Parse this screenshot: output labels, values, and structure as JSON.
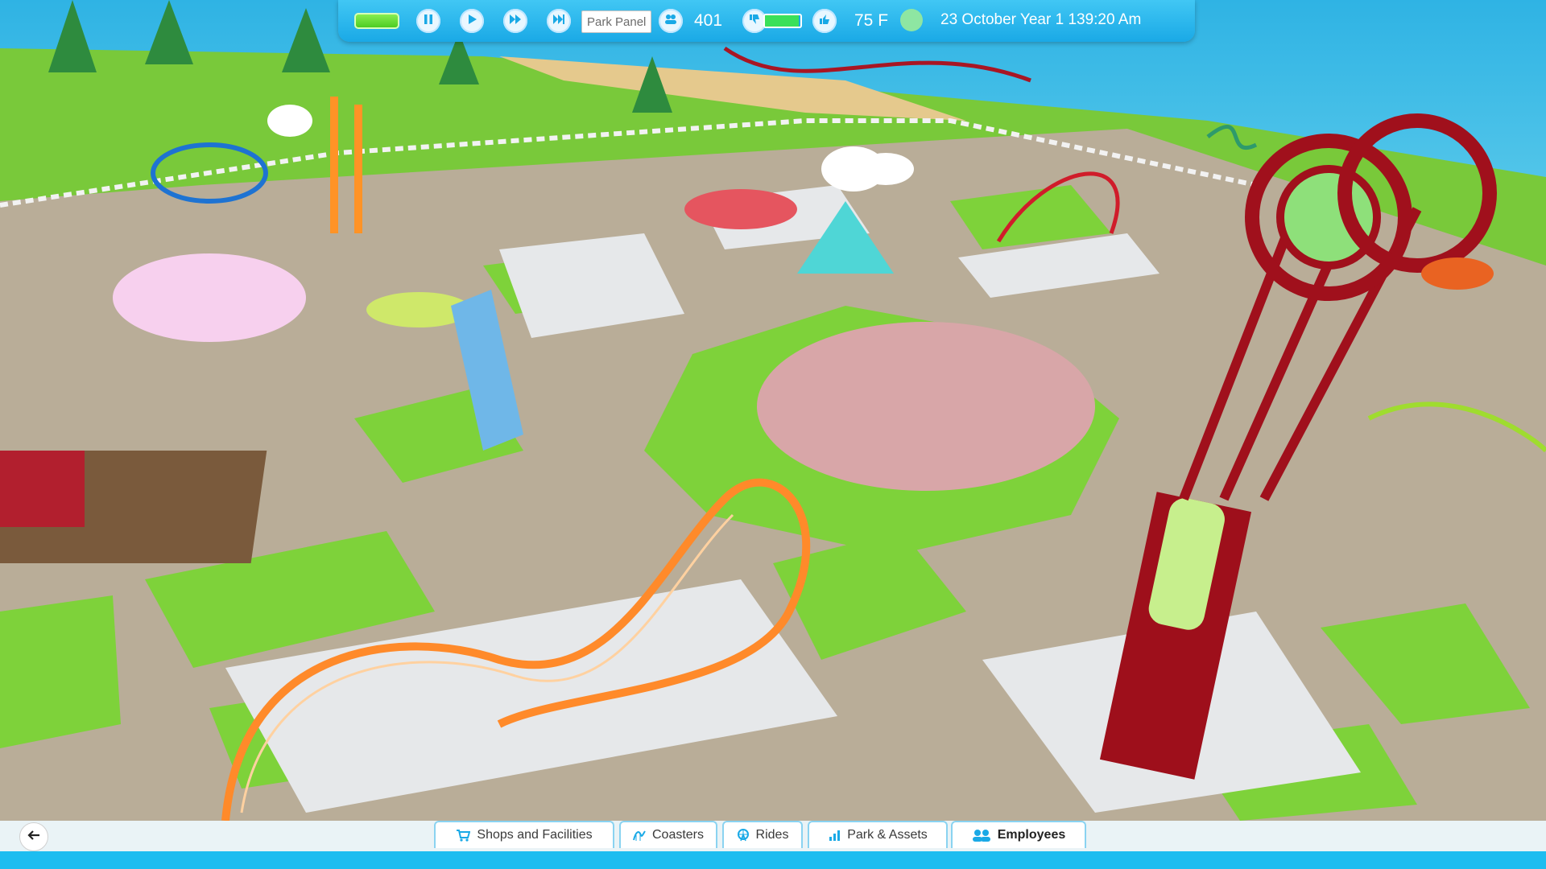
{
  "top_bar": {
    "speed_indicator": "",
    "pause_icon": "pause-icon",
    "play_icon": "play-icon",
    "fast_forward_icon": "fast-forward-icon",
    "skip_icon": "skip-forward-icon",
    "park_panel_label": "Park Panel",
    "guests_icon": "guests-icon",
    "guest_count": "401",
    "rating_icon": "thumbs-down-icon",
    "energy_icon": "battery-icon",
    "energy_level": 0.95,
    "temperature_icon": "thumbs-up-icon",
    "temperature": "75 F",
    "weather_icon": "weather-dot-icon",
    "date_time": "23 October  Year 1 139:20  Am"
  },
  "bottom_bar": {
    "back_icon": "arrow-left-icon",
    "tabs": [
      {
        "label": "Shops and Facilities",
        "icon": "cart-icon"
      },
      {
        "label": "Coasters",
        "icon": "coaster-icon"
      },
      {
        "label": "Rides",
        "icon": "ferris-wheel-icon"
      },
      {
        "label": "Park & Assets",
        "icon": "park-icon"
      },
      {
        "label": "Employees",
        "icon": "employees-icon",
        "active": true
      }
    ]
  },
  "colors": {
    "hud_blue": "#1aa9e6",
    "grass": "#7ed23a",
    "path": "#b9ad98",
    "ocean": "#36b4e2"
  }
}
